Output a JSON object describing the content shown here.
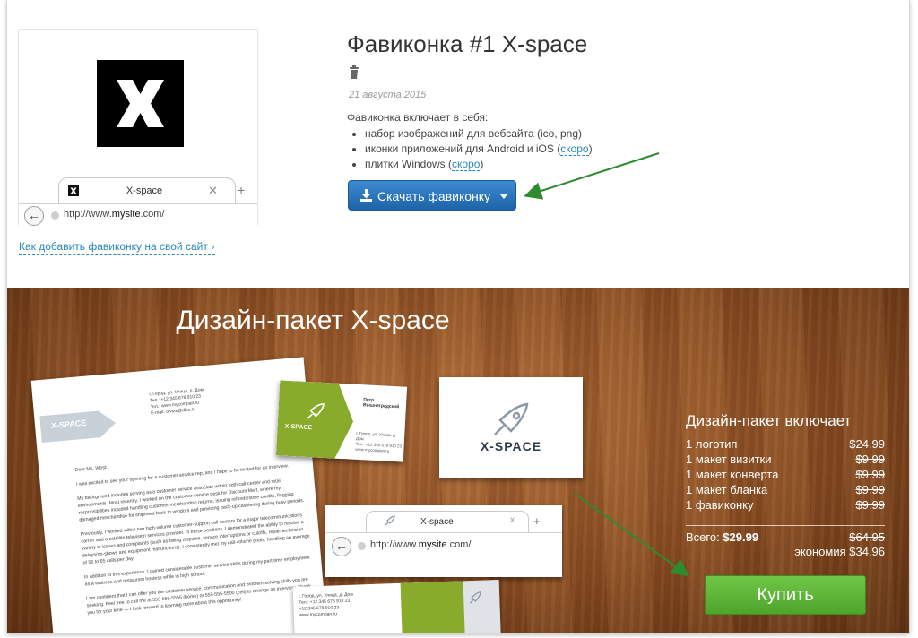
{
  "favicon": {
    "title": "Фавиконка #1 X-space",
    "date": "21 августа 2015",
    "includes_label": "Фавиконка включает в себя:",
    "items": [
      {
        "text": "набор изображений для вебсайта (ico, png)",
        "link": ""
      },
      {
        "text": "иконки приложений для Android и iOS (",
        "link": "скоро",
        "tail": ")"
      },
      {
        "text": "плитки Windows (",
        "link": "скоро",
        "tail": ")"
      }
    ],
    "download_label": "Скачать фавиконку",
    "howto_link": "Как добавить фавиконку на свой сайт",
    "howto_chevron": "›"
  },
  "browser_preview": {
    "tab_title": "X-space",
    "tab_close": "✕",
    "tab_new": "+",
    "back": "←",
    "url_prefix": "http://www.",
    "url_domain": "mysite",
    "url_suffix": ".com/"
  },
  "package": {
    "title": "Дизайн-пакет X-space",
    "includes_title": "Дизайн-пакет включает",
    "rows": [
      {
        "name": "1 логотип",
        "price": "$24.99"
      },
      {
        "name": "1 макет визитки",
        "price": "$9.99"
      },
      {
        "name": "1 макет конверта",
        "price": "$9.99"
      },
      {
        "name": "1 макет бланка",
        "price": "$9.99"
      },
      {
        "name": "1 фавиконку",
        "price": "$9.99"
      }
    ],
    "total_label": "Всего:",
    "total_value": "$29.99",
    "total_old": "$64.95",
    "savings": "экономия $34.96",
    "buy_label": "Купить"
  },
  "mockups": {
    "letter_brand": "X-SPACE",
    "letter_address": "г. Город, ул. Улица, д. Дом\nТел.: +12 345 678 910 23\nTeл.: www.mycompan.ru\nE-mail: dfvsts@dfvs.ru",
    "letter_body": "Dear Ms. West:\n\nI was excited to see your opening for a customer service rep, and I hope to be invited for an interview.\n\nMy background includes serving as a customer service associate within both call-center and retail environments. Most recently, I worked on the customer service desk for Discount Mart, where my responsibilities included handling customer merchandise returns, issuing refunds/store credits, flagging damaged merchandise for shipment back to vendors and providing back-up cashiering during busy periods.\n\nPreviously, I worked within two high-volume customer-support call centers for a major telecommunications carrier and a satellite television services provider. In these positions, I demonstrated the ability to resolve a variety of issues and complaints (such as billing disputes, service interruptions or cutoffs, repair technician delays/no-shows and equipment malfunctions). I consistently met my call-volume goals, handling an average of 56 to 65 calls per day.\n\nIn addition to this experience, I gained considerable customer service skills during my part-time employment as a waitress and restaurant hostess while in high school.\n\nI am confident that I can offer you the customer service, communication and problem-solving skills you are seeking. Feel free to call me at 555-555-5555 (home) or 555-555-5500 (cell) to arrange an interview. Thank you for your time — I look forward to learning more about this opportunity!",
    "card1_brand": "X-SPACE",
    "card1_name": "Петр Вышнеградский",
    "card1_address": "г. Город, ул. Улица, д. Дом\nТел.: +12 345 678 910 23\nwww.mycompan.ru",
    "card2_brand": "X-SPACE",
    "window_title": "X-space",
    "window_close": "x",
    "window_new": "+",
    "window_url_prefix": "http://www.",
    "window_url_domain": "mysite",
    "window_url_suffix": ".com/",
    "card3_address": "г. Город, ул. Улица, д. Дом\nТел.: +12 345 678 910 23\n+12 345 678 910 23\nwww.mycompan.ru"
  },
  "colors": {
    "link": "#2a87b8",
    "download_button": "#2c76bd",
    "buy_button": "#5cb537",
    "annotation_arrow": "#2e8b2e",
    "mockup_green": "#88ab2b"
  }
}
